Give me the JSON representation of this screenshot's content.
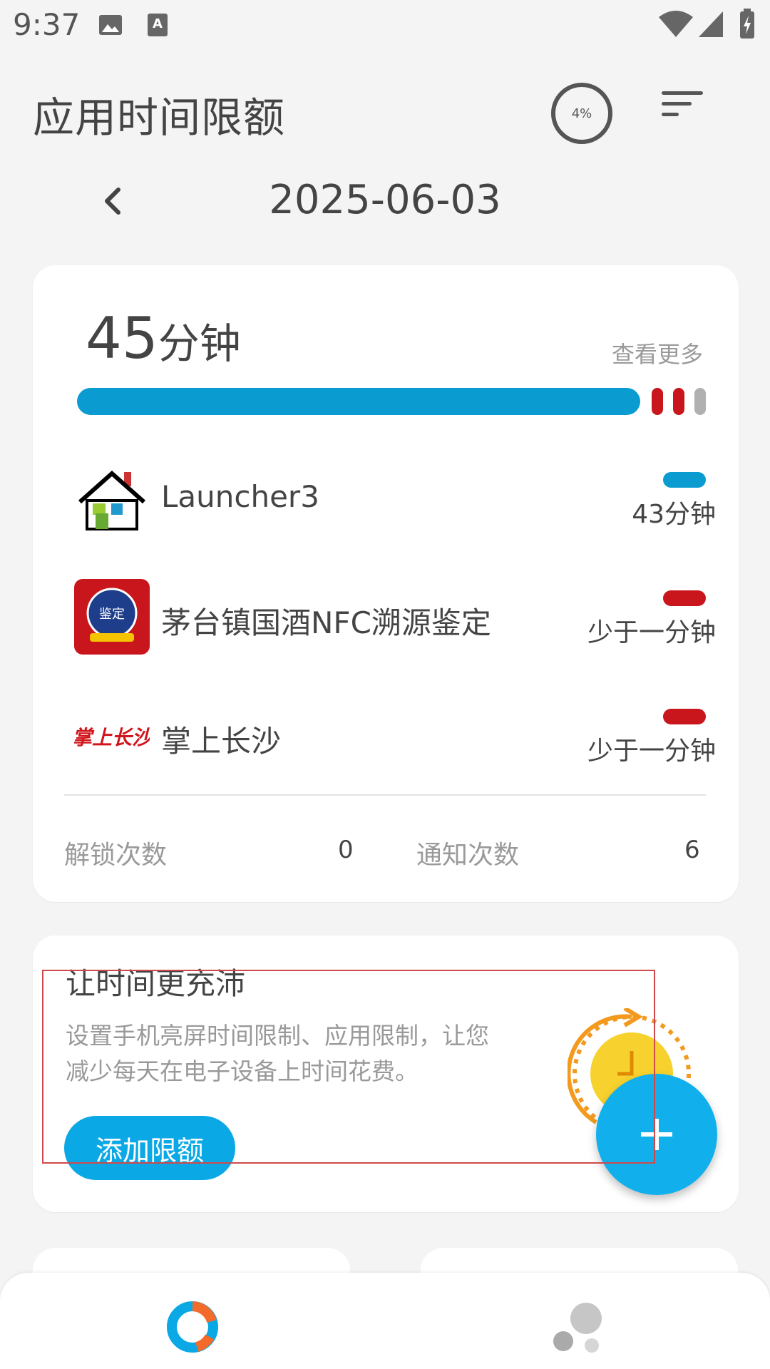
{
  "status_bar": {
    "time": "9:37"
  },
  "header": {
    "title": "应用时间限额",
    "usage_percent": "4%"
  },
  "date_nav": {
    "date": "2025-06-03"
  },
  "usage_card": {
    "total_value": "45",
    "total_unit": "分钟",
    "see_more": "查看更多",
    "bar_colors": {
      "main": "#0a9bd1",
      "red": "#c9161c",
      "gray": "#b0b0b0"
    },
    "apps": [
      {
        "name": "Launcher3",
        "duration": "43分钟",
        "color": "#0a9bd1"
      },
      {
        "name": "茅台镇国酒NFC溯源鉴定",
        "duration": "少于一分钟",
        "color": "#c9161c",
        "icon_text": "鉴定"
      },
      {
        "name": "掌上长沙",
        "duration": "少于一分钟",
        "color": "#c9161c",
        "icon_text": "掌上长沙"
      }
    ],
    "unlock_label": "解锁次数",
    "unlock_value": "0",
    "notify_label": "通知次数",
    "notify_value": "6"
  },
  "promo_card": {
    "title": "让时间更充沛",
    "description": "设置手机亮屏时间限制、应用限制，让您减少每天在电子设备上时间花费。",
    "button": "添加限额"
  },
  "bottom_nav": {
    "items": [
      "usage-tab",
      "more-tab"
    ]
  }
}
